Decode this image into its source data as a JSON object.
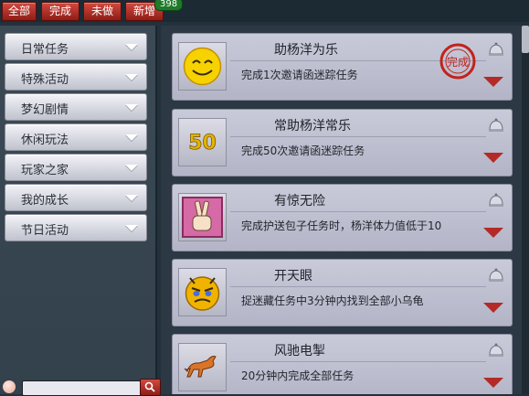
{
  "tabs": [
    {
      "label": "全部"
    },
    {
      "label": "完成"
    },
    {
      "label": "未做"
    },
    {
      "label": "新增"
    }
  ],
  "new_count_badge": "398",
  "sidebar": {
    "items": [
      {
        "label": "日常任务"
      },
      {
        "label": "特殊活动"
      },
      {
        "label": "梦幻剧情"
      },
      {
        "label": "休闲玩法"
      },
      {
        "label": "玩家之家"
      },
      {
        "label": "我的成长"
      },
      {
        "label": "节日活动"
      }
    ]
  },
  "tasks": [
    {
      "title": "助杨洋为乐",
      "desc": "完成1次邀请函迷踪任务",
      "icon": "smiley-icon",
      "completed": true,
      "stamp_text": "完成"
    },
    {
      "title": "常助杨洋常乐",
      "desc": "完成50次邀请函迷踪任务",
      "icon": "fifty-icon",
      "icon_text": "50",
      "completed": false
    },
    {
      "title": "有惊无险",
      "desc": "完成护送包子任务时，杨洋体力值低于10",
      "icon": "victory-hand-icon",
      "completed": false
    },
    {
      "title": "开天眼",
      "desc": "捉迷藏任务中3分钟内找到全部小乌龟",
      "icon": "angry-face-icon",
      "completed": false
    },
    {
      "title": "风驰电掣",
      "desc": "20分钟内完成全部任务",
      "icon": "horse-icon",
      "completed": false
    }
  ],
  "colors": {
    "accent_red": "#b32a26",
    "tab_red": "#c0392b",
    "badge_green": "#1f7a2a"
  }
}
